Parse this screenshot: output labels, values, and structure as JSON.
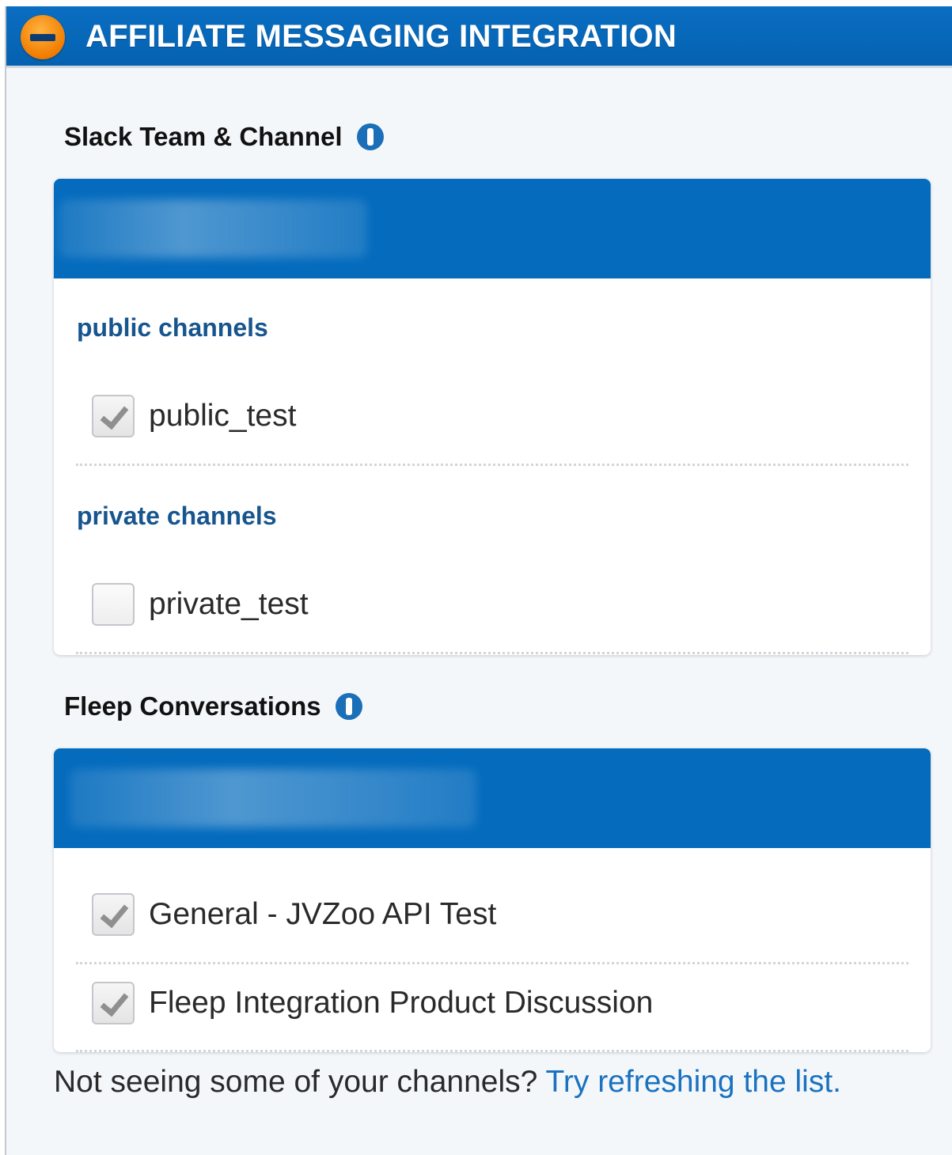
{
  "header": {
    "title": "AFFILIATE MESSAGING INTEGRATION",
    "collapse_icon": "minus-circle-icon",
    "accent_color": "#f07c00",
    "bar_color": "#0561b0"
  },
  "slack": {
    "title": "Slack Team & Channel",
    "info_icon": "info-icon",
    "public_label": "public channels",
    "private_label": "private channels",
    "public_channels": [
      {
        "label": "public_test",
        "checked": true
      }
    ],
    "private_channels": [
      {
        "label": "private_test",
        "checked": false
      }
    ]
  },
  "fleep": {
    "title": "Fleep Conversations",
    "info_icon": "info-icon",
    "conversations": [
      {
        "label": "General - JVZoo API Test",
        "checked": true
      },
      {
        "label": "Fleep Integration Product Discussion",
        "checked": true
      }
    ]
  },
  "footer": {
    "text": "Not seeing some of your channels?",
    "link_text": "Try refreshing the list."
  }
}
